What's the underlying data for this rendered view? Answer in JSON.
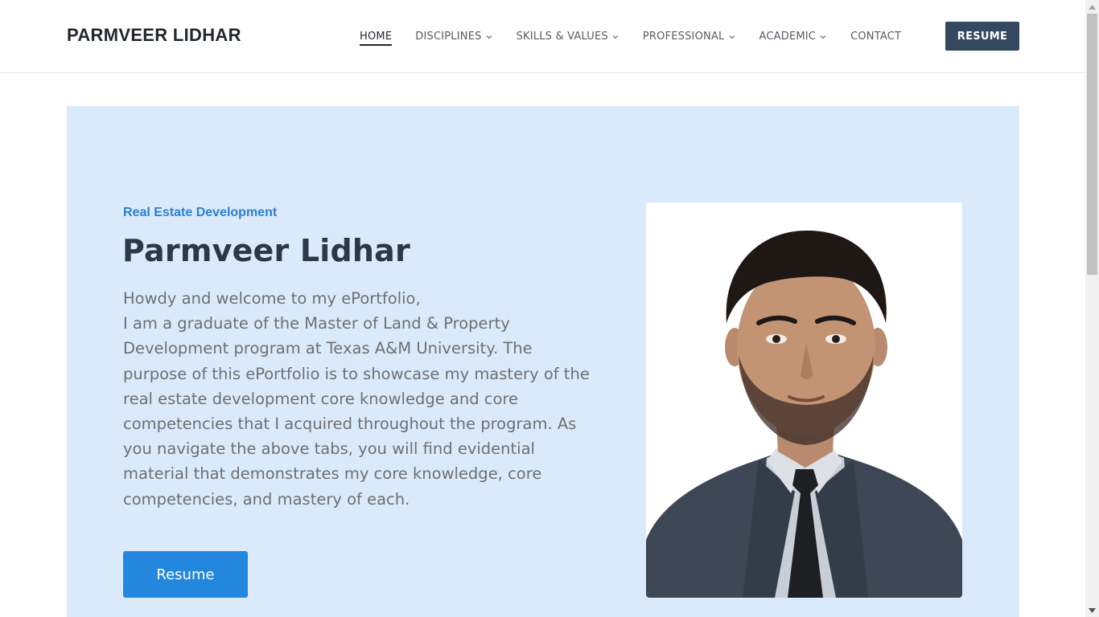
{
  "header": {
    "brand": "PARMVEER LIDHAR",
    "nav": [
      {
        "label": "HOME",
        "active": true,
        "dropdown": false
      },
      {
        "label": "DISCIPLINES",
        "active": false,
        "dropdown": true
      },
      {
        "label": "SKILLS & VALUES",
        "active": false,
        "dropdown": true
      },
      {
        "label": "PROFESSIONAL",
        "active": false,
        "dropdown": true
      },
      {
        "label": "ACADEMIC",
        "active": false,
        "dropdown": true
      },
      {
        "label": "CONTACT",
        "active": false,
        "dropdown": false
      }
    ],
    "resume_label": "RESUME"
  },
  "hero": {
    "eyebrow": "Real Estate Development",
    "title": "Parmveer Lidhar",
    "intro_line1": "Howdy and welcome to my ePortfolio,",
    "intro_line2": "I am a graduate of the Master of Land & Property Development program at Texas A&M University. The purpose of this ePortfolio is to showcase my mastery of the real estate development core knowledge and core competencies that I acquired throughout the program. As you navigate the above tabs, you will find evidential material that demonstrates my core knowledge, core competencies, and mastery of each.",
    "button_label": "Resume"
  },
  "colors": {
    "hero_bg": "#dbeafa",
    "accent": "#2387dd",
    "header_button": "#34495f",
    "heading": "#2a3847"
  },
  "icons": {
    "nav_dropdown": "chevron-down-icon",
    "portrait": "portrait-photo"
  }
}
